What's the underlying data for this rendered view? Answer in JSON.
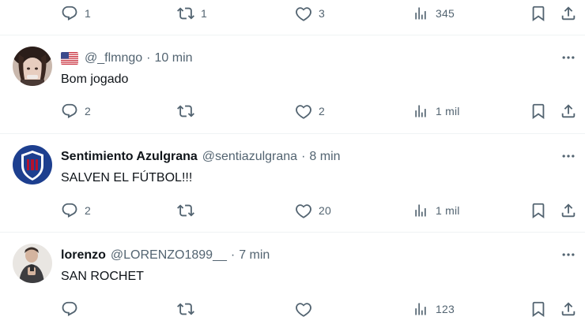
{
  "top_actions": {
    "replies": "1",
    "retweets": "1",
    "likes": "3",
    "views": "345"
  },
  "tweets": [
    {
      "name": "",
      "handle": "@_flmngo",
      "time": "10 min",
      "flag": "us-flag",
      "text": "Bom jogado",
      "actions": {
        "replies": "2",
        "retweets": "",
        "likes": "2",
        "views": "1 mil"
      }
    },
    {
      "name": "Sentimiento Azulgrana",
      "handle": "@sentiazulgrana",
      "time": "8 min",
      "text": "SALVEN EL FÚTBOL!!!",
      "actions": {
        "replies": "2",
        "retweets": "",
        "likes": "20",
        "views": "1 mil"
      }
    },
    {
      "name": "lorenzo",
      "handle": "@LORENZO1899__",
      "time": "7 min",
      "text": "SAN ROCHET",
      "actions": {
        "replies": "",
        "retweets": "",
        "likes": "",
        "views": "123"
      }
    }
  ],
  "separator": "·",
  "colors": {
    "text": "#0f1419",
    "secondary": "#536471",
    "divider": "#eff3f4",
    "badge_blue": "#1d3f8f",
    "badge_red": "#b3122f"
  }
}
